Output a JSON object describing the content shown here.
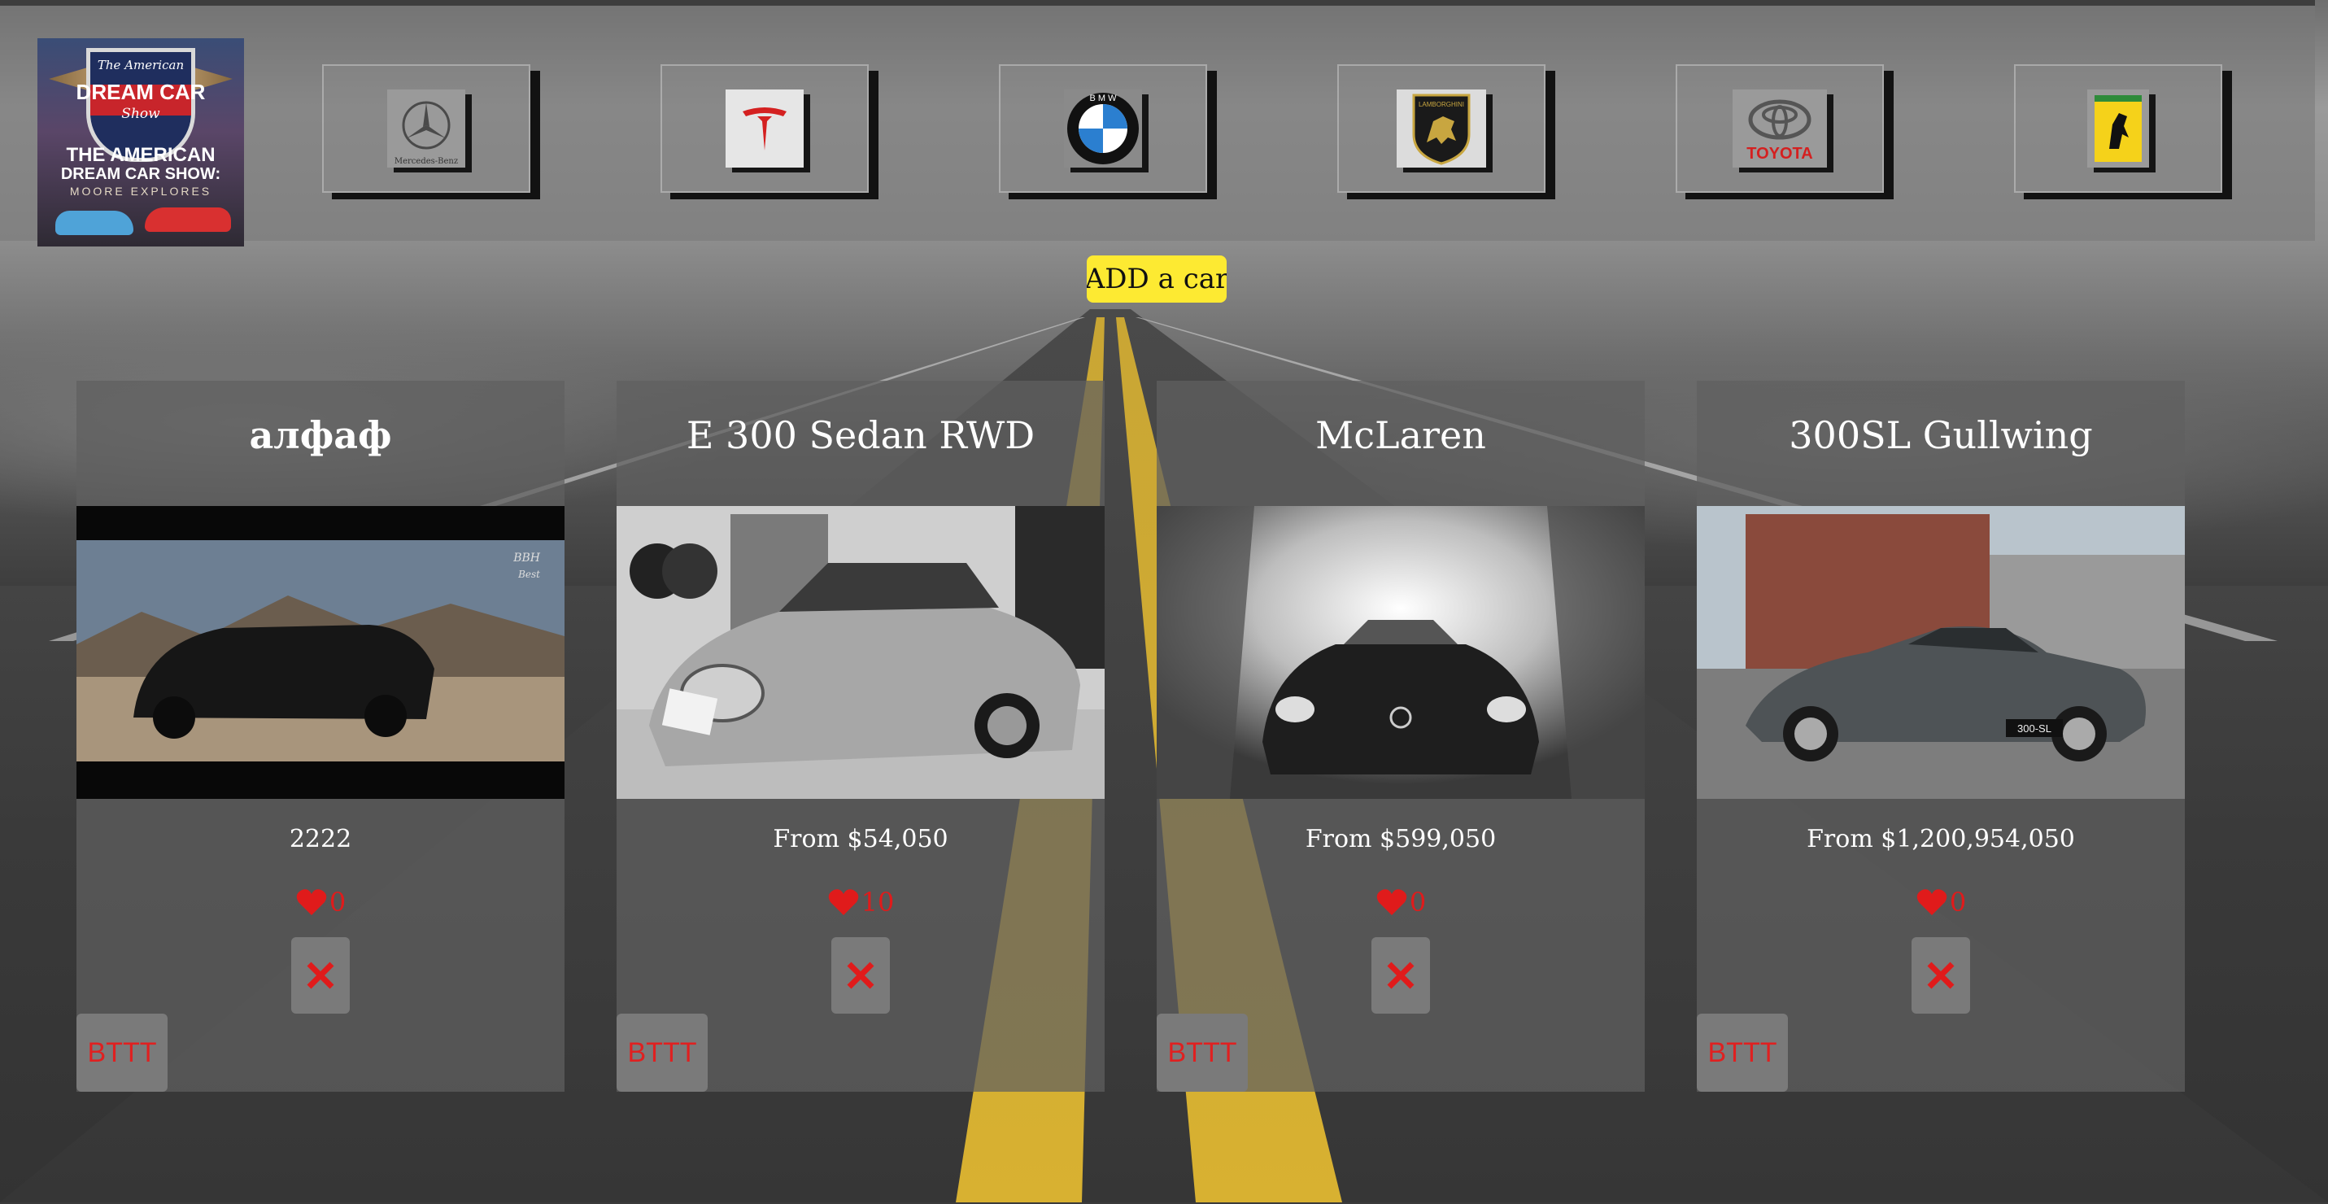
{
  "header": {
    "logo": {
      "top_line": "The American",
      "title": "DREAM CAR",
      "subtitle": "Show",
      "bottom_line1": "THE AMERICAN",
      "bottom_line2": "DREAM CAR SHOW:",
      "bottom_line3": "MOORE EXPLORES"
    },
    "brands": [
      {
        "name": "Mercedes-Benz",
        "caption": "Mercedes-Benz"
      },
      {
        "name": "Tesla"
      },
      {
        "name": "BMW",
        "caption": "B M W"
      },
      {
        "name": "Lamborghini",
        "caption": "LAMBORGHINI"
      },
      {
        "name": "Toyota",
        "caption": "TOYOTA"
      },
      {
        "name": "Ferrari"
      }
    ]
  },
  "add_button": {
    "label": "ADD a car"
  },
  "cards": [
    {
      "title": "алфаф",
      "price": "2222",
      "likes": "0",
      "delete_icon": "close-x-icon",
      "action_label": "BTTT",
      "photo_watermark": "BBH\nBest"
    },
    {
      "title": "E 300 Sedan RWD",
      "price": "From $54,050",
      "likes": "10",
      "delete_icon": "close-x-icon",
      "action_label": "BTTT"
    },
    {
      "title": "McLaren",
      "price": "From $599,050",
      "likes": "0",
      "delete_icon": "close-x-icon",
      "action_label": "BTTT"
    },
    {
      "title": "300SL Gullwing",
      "price": "From $1,200,954,050",
      "likes": "0",
      "delete_icon": "close-x-icon",
      "action_label": "BTTT",
      "plate": "300-SL"
    }
  ],
  "colors": {
    "accent_yellow": "#fdea32",
    "like_red": "#e01b1b",
    "card_bg": "rgba(95,95,95,0.72)"
  }
}
